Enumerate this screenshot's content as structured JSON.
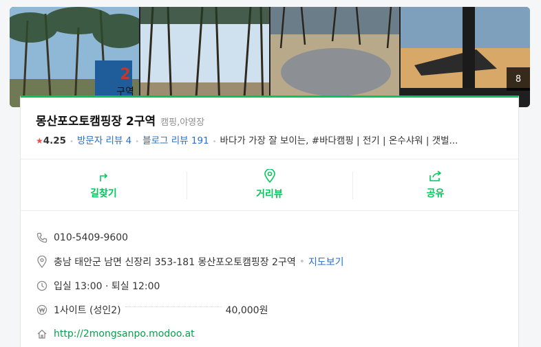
{
  "photo_count": "8",
  "place": {
    "name": "몽산포오토캠핑장 2구역",
    "category": "캠핑,야영장",
    "rating": "4.25",
    "visitor_review": "방문자 리뷰 4",
    "blog_review": "블로그 리뷰 191",
    "summary": "바다가 가장 잘 보이는, #바다캠핑 | 전기 | 온수샤워 | 갯벌..."
  },
  "photo_sign": {
    "number": "2",
    "text": "구역"
  },
  "actions": [
    {
      "label": "길찾기",
      "icon": "directions-icon"
    },
    {
      "label": "거리뷰",
      "icon": "location-pin-icon"
    },
    {
      "label": "공유",
      "icon": "share-icon"
    }
  ],
  "info": {
    "phone": "010-5409-9600",
    "address": "충남 태안군 남면 신장리 353-181 몽산포오토캠핑장 2구역",
    "map_link": "지도보기",
    "hours": "입실 13:00 · 퇴실 12:00",
    "price_item": "1사이트 (성인2)",
    "price_value": "40,000원",
    "website": "http://2mongsanpo.modoo.at"
  },
  "colors": {
    "accent": "#03c75a",
    "link": "#2a6ec9",
    "star": "#f04c4c"
  }
}
